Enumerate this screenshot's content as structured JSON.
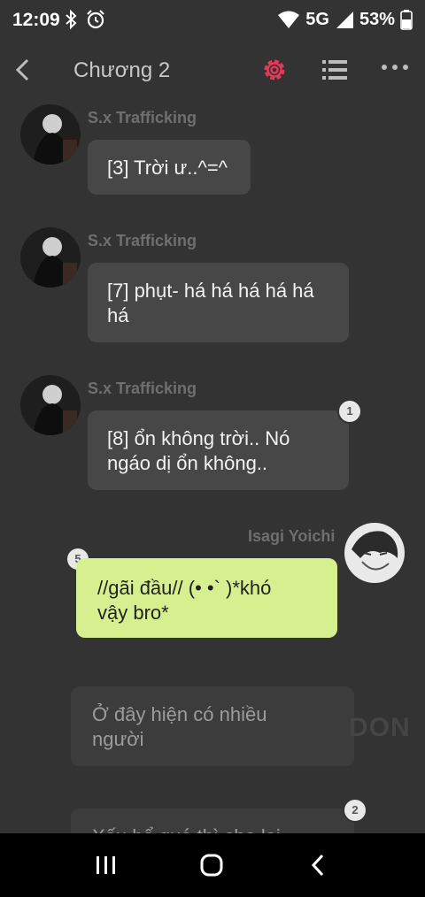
{
  "status_bar": {
    "time": "12:09",
    "network": "5G",
    "battery": "53%"
  },
  "header": {
    "title": "Chương 2"
  },
  "colors": {
    "accent": "#e8385a",
    "self_bubble": "#d6ef8f",
    "other_bubble": "#474747"
  },
  "messages": [
    {
      "sender": "S.x Trafficking",
      "text": "[3] Trời ư..^=^",
      "badge": ""
    },
    {
      "sender": "S.x Trafficking",
      "text_line1": "[7] phụt- há há há há há",
      "text_line2": "há",
      "badge": ""
    },
    {
      "sender": "S.x Trafficking",
      "text_line1": "[8] ổn không trời.. Nó",
      "text_line2": "ngáo dị ổn không..",
      "badge": "1"
    },
    {
      "sender": "Isagi Yoichi",
      "text_line1": "//gãi đầu// (• •` )*khó",
      "text_line2": "vậy bro*",
      "badge": "5"
    },
    {
      "text_line1": "Ở đây hiện có nhiều",
      "text_line2": "người"
    },
    {
      "text_line1": "Xấu hổ quá thì che lại",
      "badge": "2"
    }
  ],
  "watermark": "DON"
}
